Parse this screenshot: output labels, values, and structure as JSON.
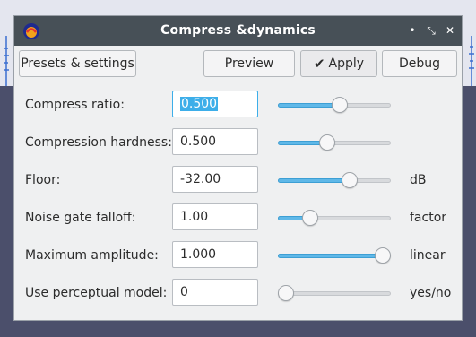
{
  "dialog": {
    "title": "Compress &dynamics",
    "window_buttons": {
      "minimize": "•",
      "maximize": "⤡",
      "close": "✕"
    }
  },
  "toolbar": {
    "presets_label": "Presets & settings",
    "preview_label": "Preview",
    "apply_label": "Apply",
    "apply_icon": "✔",
    "debug_label": "Debug"
  },
  "params": [
    {
      "label": "Compress ratio:",
      "value": "0.500",
      "unit": "",
      "slider_fraction": 0.56,
      "focused": true
    },
    {
      "label": "Compression hardness:",
      "value": "0.500",
      "unit": "",
      "slider_fraction": 0.43,
      "focused": false
    },
    {
      "label": "Floor:",
      "value": "-32.00",
      "unit": "dB",
      "slider_fraction": 0.66,
      "focused": false
    },
    {
      "label": "Noise gate falloff:",
      "value": "1.00",
      "unit": "factor",
      "slider_fraction": 0.25,
      "focused": false
    },
    {
      "label": "Maximum amplitude:",
      "value": "1.000",
      "unit": "linear",
      "slider_fraction": 1.0,
      "focused": false
    },
    {
      "label": "Use perceptual model:",
      "value": "0",
      "unit": "yes/no",
      "slider_fraction": 0.0,
      "focused": false
    }
  ],
  "colors": {
    "titlebar": "#475057",
    "accent": "#3daee9",
    "slider_fill": "#5fb8e8",
    "dialog_bg": "#eff0f1",
    "backdrop": "#4b4f6b"
  }
}
